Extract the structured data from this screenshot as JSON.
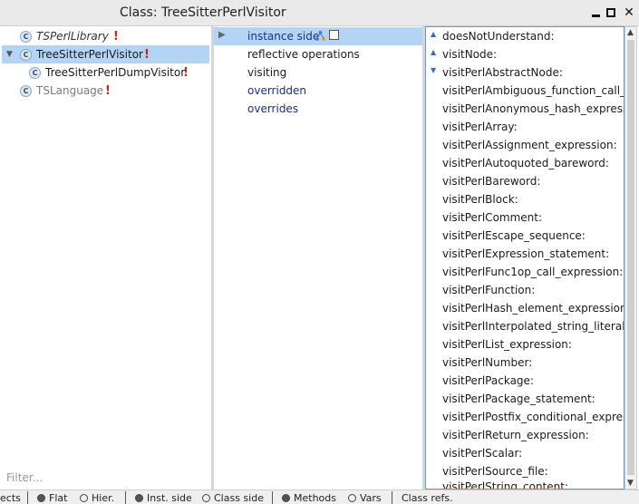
{
  "window": {
    "title": "Class: TreeSitterPerlVisitor"
  },
  "classes": {
    "items": [
      {
        "name": "TSPerlLibrary",
        "icon": "C",
        "warning": "!"
      },
      {
        "name": "TreeSitterPerlVisitor",
        "icon": "C",
        "warning": "!",
        "twisty": "▼"
      },
      {
        "name": "TreeSitterPerlDumpVisitor",
        "icon": "C",
        "warning": "!"
      },
      {
        "name": "TSLanguage",
        "icon": "C",
        "warning": "!"
      }
    ],
    "filter_placeholder": "Filter..."
  },
  "protocols": {
    "items": [
      {
        "label": "instance side",
        "twisty": "▶"
      },
      {
        "label": "reflective operations"
      },
      {
        "label": "visiting"
      },
      {
        "label": "overridden"
      },
      {
        "label": "overrides"
      }
    ]
  },
  "methods": {
    "items": [
      {
        "arrow": "▲",
        "label": "doesNotUnderstand:"
      },
      {
        "arrow": "▲",
        "label": "visitNode:"
      },
      {
        "arrow": "▼",
        "label": "visitPerlAbstractNode:"
      },
      {
        "label": "visitPerlAmbiguous_function_call_ex"
      },
      {
        "label": "visitPerlAnonymous_hash_expression"
      },
      {
        "label": "visitPerlArray:"
      },
      {
        "label": "visitPerlAssignment_expression:"
      },
      {
        "label": "visitPerlAutoquoted_bareword:"
      },
      {
        "label": "visitPerlBareword:"
      },
      {
        "label": "visitPerlBlock:"
      },
      {
        "label": "visitPerlComment:"
      },
      {
        "label": "visitPerlEscape_sequence:"
      },
      {
        "label": "visitPerlExpression_statement:"
      },
      {
        "label": "visitPerlFunc1op_call_expression:"
      },
      {
        "label": "visitPerlFunction:"
      },
      {
        "label": "visitPerlHash_element_expression:"
      },
      {
        "label": "visitPerlInterpolated_string_literal:"
      },
      {
        "label": "visitPerlList_expression:"
      },
      {
        "label": "visitPerlNumber:"
      },
      {
        "label": "visitPerlPackage:"
      },
      {
        "label": "visitPerlPackage_statement:"
      },
      {
        "label": "visitPerlPostfix_conditional_expressi"
      },
      {
        "label": "visitPerlReturn_expression:"
      },
      {
        "label": "visitPerlScalar:"
      },
      {
        "label": "visitPerlSource_file:"
      },
      {
        "label": "visitPerlString_content:"
      }
    ]
  },
  "scrollbar": {
    "up": "▲",
    "down": "▼"
  },
  "bottombar": {
    "projects_label": "ects",
    "flat_label": "Flat",
    "hier_label": "Hier.",
    "inst_side_label": "Inst. side",
    "class_side_label": "Class side",
    "methods_label": "Methods",
    "vars_label": "Vars",
    "class_refs_label": "Class refs."
  },
  "colors": {
    "selection": "#b3d4f5",
    "warning": "#c0281d",
    "protocol_link": "#1a2e8a",
    "focus_border": "#5b9bd5"
  }
}
